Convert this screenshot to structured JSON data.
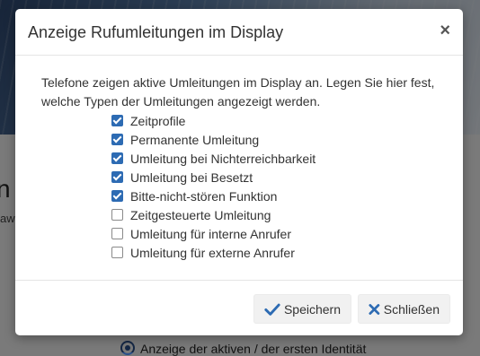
{
  "background": {
    "heading": "n",
    "subtext": "awe",
    "radio_option": "Anzeige der aktiven / der ersten Identität"
  },
  "modal": {
    "title": "Anzeige Rufumleitungen im Display",
    "close_symbol": "×",
    "description": "Telefone zeigen aktive Umleitungen im Display an. Legen Sie hier fest, welche Typen der Umleitungen angezeigt werden.",
    "options": [
      {
        "label": "Zeitprofile",
        "checked": true
      },
      {
        "label": "Permanente Umleitung",
        "checked": true
      },
      {
        "label": "Umleitung bei Nichterreichbarkeit",
        "checked": true
      },
      {
        "label": "Umleitung bei Besetzt",
        "checked": true
      },
      {
        "label": "Bitte-nicht-stören Funktion",
        "checked": true
      },
      {
        "label": "Zeitgesteuerte Umleitung",
        "checked": false
      },
      {
        "label": "Umleitung für interne Anrufer",
        "checked": false
      },
      {
        "label": "Umleitung für externe Anrufer",
        "checked": false
      }
    ],
    "save_label": "Speichern",
    "close_label": "Schließen",
    "save_icon": "check-icon",
    "close_icon": "x-icon",
    "accent_color": "#2d6bb3"
  }
}
